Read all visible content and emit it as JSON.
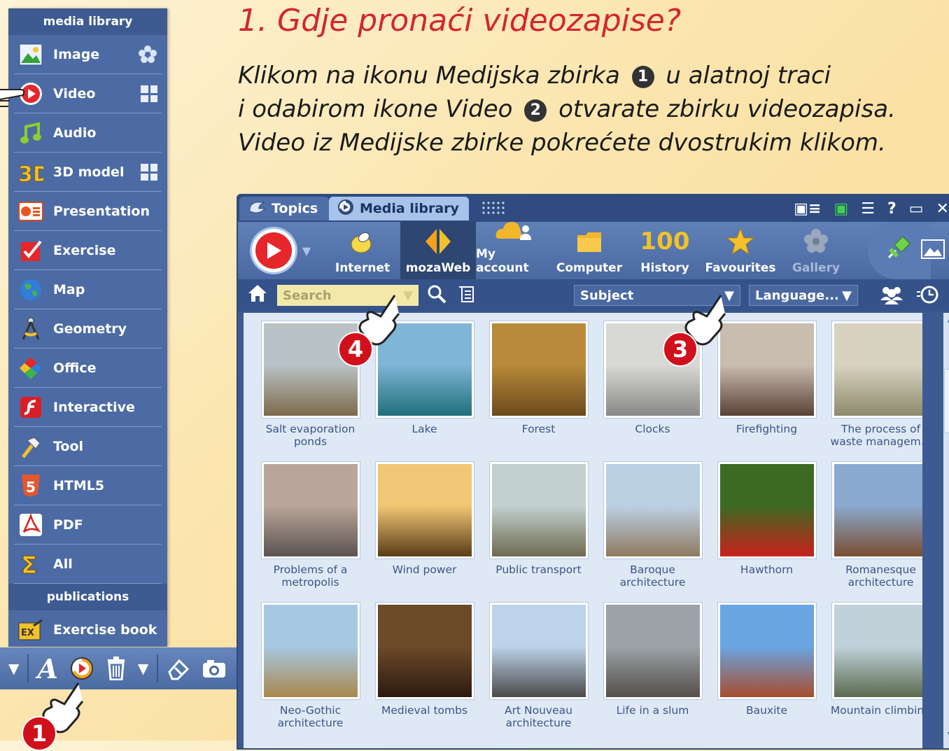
{
  "sidebar": {
    "header": "media library",
    "items": [
      {
        "label": "Image",
        "icon": "image-icon"
      },
      {
        "label": "Video",
        "icon": "video-icon"
      },
      {
        "label": "Audio",
        "icon": "audio-icon"
      },
      {
        "label": "3D model",
        "icon": "3d-icon"
      },
      {
        "label": "Presentation",
        "icon": "presentation-icon"
      },
      {
        "label": "Exercise",
        "icon": "exercise-icon"
      },
      {
        "label": "Map",
        "icon": "globe-icon"
      },
      {
        "label": "Geometry",
        "icon": "compass-icon"
      },
      {
        "label": "Office",
        "icon": "office-icon"
      },
      {
        "label": "Interactive",
        "icon": "flash-icon"
      },
      {
        "label": "Tool",
        "icon": "hammer-icon"
      },
      {
        "label": "HTML5",
        "icon": "html5-icon"
      },
      {
        "label": "PDF",
        "icon": "pdf-icon"
      },
      {
        "label": "All",
        "icon": "sigma-icon"
      }
    ],
    "section": "publications",
    "exercise_book": "Exercise book"
  },
  "instructions": {
    "title": "1. Gdje pronaći videozapise?",
    "line1_a": "Klikom na ikonu Medijska zbirka",
    "num1": "1",
    "line1_b": "u alatnoj traci",
    "line2_a": "i odabirom ikone Video",
    "num2": "2",
    "line2_b": "otvarate zbirku videozapisa.",
    "line3": "Video iz Medijske zbirke pokrećete dvostrukim klikom."
  },
  "window": {
    "tabs": {
      "topics": "Topics",
      "media": "Media library"
    },
    "ribbon": {
      "internet": "Internet",
      "mozaweb": "mozaWeb",
      "my_account": "My account",
      "computer": "Computer",
      "history": "History",
      "history_icon_text": "100",
      "favourites": "Favourites",
      "gallery": "Gallery"
    },
    "search": {
      "placeholder": "Search"
    },
    "subject": "Subject",
    "language": "Language...",
    "thumbnails": [
      {
        "caption": "Salt evaporation ponds",
        "colors": [
          "#b9c3c6",
          "#7d6a4c"
        ]
      },
      {
        "caption": "Lake",
        "colors": [
          "#7fb5d6",
          "#1f6f7a"
        ]
      },
      {
        "caption": "Forest",
        "colors": [
          "#b88a3a",
          "#6b4a1c"
        ]
      },
      {
        "caption": "Clocks",
        "colors": [
          "#d8d8d4",
          "#888"
        ]
      },
      {
        "caption": "Firefighting",
        "colors": [
          "#c9bdb0",
          "#5a4035"
        ]
      },
      {
        "caption": "The process of waste managem...",
        "colors": [
          "#d8d3c0",
          "#8c8a6c"
        ]
      },
      {
        "caption": "Problems of a metropolis",
        "colors": [
          "#b9a69a",
          "#5b5350"
        ]
      },
      {
        "caption": "Wind power",
        "colors": [
          "#f1c775",
          "#5a3c18"
        ]
      },
      {
        "caption": "Public transport",
        "colors": [
          "#c2d0cf",
          "#6f6a50"
        ]
      },
      {
        "caption": "Baroque architecture",
        "colors": [
          "#bcd0e4",
          "#8f7a60"
        ]
      },
      {
        "caption": "Hawthorn",
        "colors": [
          "#3d6a22",
          "#c8201b"
        ]
      },
      {
        "caption": "Romanesque architecture",
        "colors": [
          "#8aa9cf",
          "#7a4e30"
        ]
      },
      {
        "caption": "Neo-Gothic architecture",
        "colors": [
          "#a7c8e2",
          "#a8884d"
        ]
      },
      {
        "caption": "Medieval tombs",
        "colors": [
          "#6d4a2a",
          "#2b1a0f"
        ]
      },
      {
        "caption": "Art Nouveau architecture",
        "colors": [
          "#bcd3ea",
          "#4a4a4a"
        ]
      },
      {
        "caption": "Life in a slum",
        "colors": [
          "#9ca3a8",
          "#554f4a"
        ]
      },
      {
        "caption": "Bauxite",
        "colors": [
          "#6aa5e3",
          "#a74d2e"
        ]
      },
      {
        "caption": "Mountain climbing",
        "colors": [
          "#c0d1da",
          "#5b6b4f"
        ]
      }
    ]
  },
  "callouts": {
    "n1": "1",
    "n3": "3",
    "n4": "4"
  },
  "colors": {
    "accent_red": "#d22630",
    "sidebar_blue": "#4c6ba4",
    "badge_red": "#d0101b"
  }
}
